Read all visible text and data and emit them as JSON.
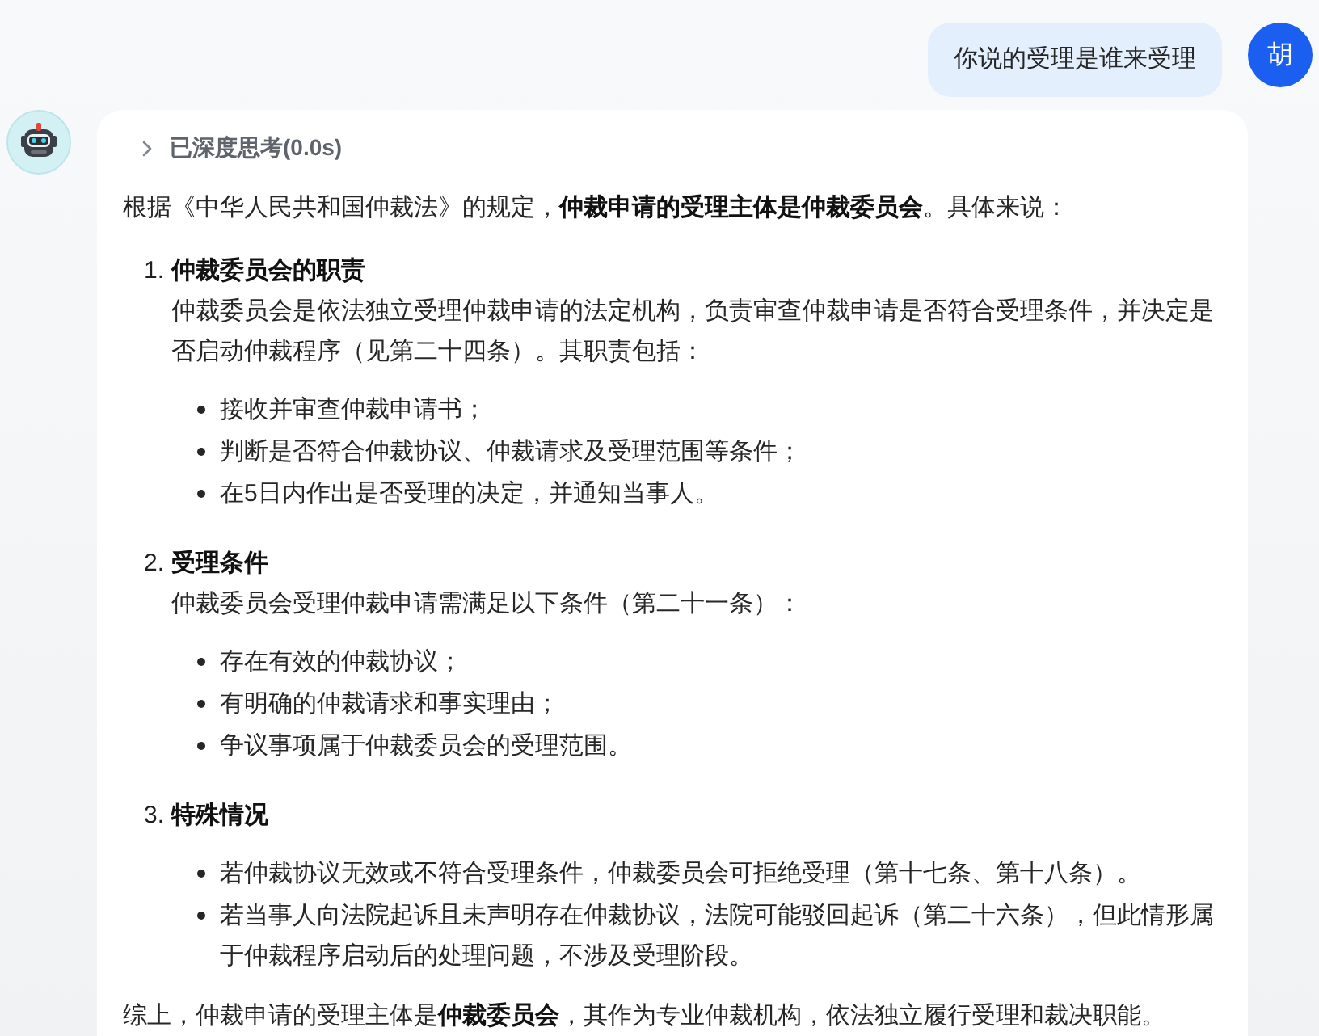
{
  "user_message": {
    "text": "你说的受理是谁来受理",
    "avatar": "胡"
  },
  "answer": {
    "thinking": {
      "label": "已深度思考(0.0s)",
      "expanded": false
    },
    "intro": "根据《中华人民共和国仲裁法》的规定，**仲裁申请的受理主体是仲裁委员会**。具体来说：",
    "sections": [
      {
        "number": "1.",
        "title": "仲裁委员会的职责",
        "description": "仲裁委员会是依法独立受理仲裁申请的法定机构，负责审查仲裁申请是否符合受理条件，并决定是否启动仲裁程序（见第二十四条）。其职责包括：",
        "bullets": [
          "接收并审查仲裁申请书；",
          "判断是否符合仲裁协议、仲裁请求及受理范围等条件；",
          "在5日内作出是否受理的决定，并通知当事人。"
        ]
      },
      {
        "number": "2.",
        "title": "受理条件",
        "description": "仲裁委员会受理仲裁申请需满足以下条件（第二十一条）：",
        "bullets": [
          "存在有效的仲裁协议；",
          "有明确的仲裁请求和事实理由；",
          "争议事项属于仲裁委员会的受理范围。"
        ]
      },
      {
        "number": "3.",
        "title": "特殊情况",
        "bullets": [
          "若仲裁协议无效或不符合受理条件，仲裁委员会可拒绝受理（第十七条、第十八条）。",
          "若当事人向法院起诉且未声明存在仲裁协议，法院可能驳回起诉（第二十六条），但此情形属于仲裁程序启动后的处理问题，不涉及受理阶段。"
        ]
      }
    ],
    "conclusion": "综上，仲裁申请的受理主体是**仲裁委员会**，其作为专业仲裁机构，依法独立履行受理和裁决职能。"
  }
}
